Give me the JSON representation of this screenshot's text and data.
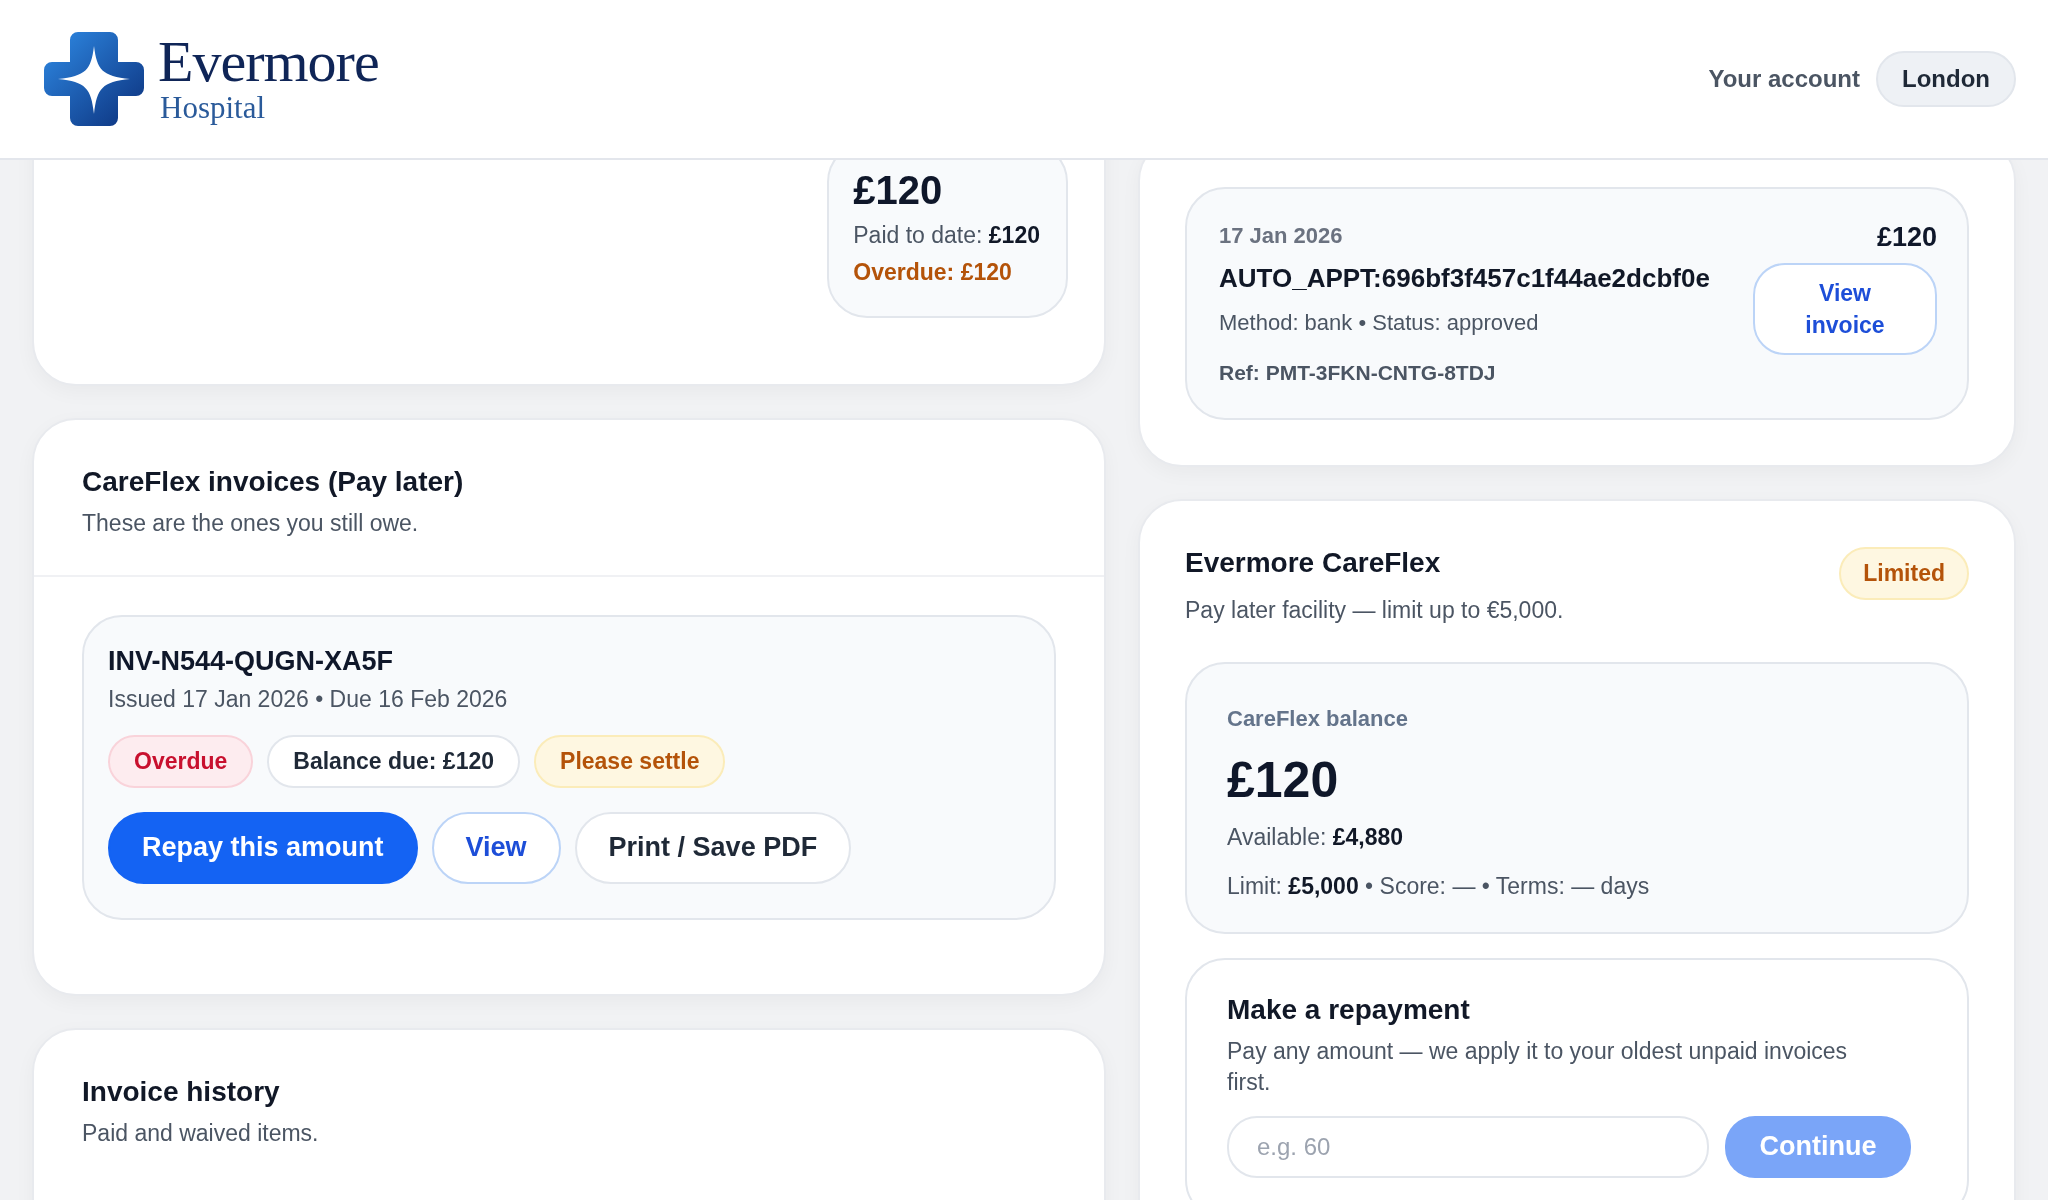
{
  "header": {
    "logo": {
      "name": "Evermore",
      "subtitle": "Hospital"
    },
    "account_link": "Your account",
    "location": "London"
  },
  "summary_card": {
    "amount": "£120",
    "paid_to_date": "Paid to date: **£120**",
    "overdue": "Overdue: £120"
  },
  "careflex_invoices": {
    "title": "CareFlex invoices (Pay later)",
    "subtitle": "These are the ones you still owe.",
    "invoices": [
      {
        "number": "INV-N544-QUGN-XA5F",
        "dates": "Issued 17 Jan 2026 • Due 16 Feb 2026",
        "tags": [
          {
            "label": "Overdue",
            "kind": "danger"
          },
          {
            "label": "Balance due: £120",
            "kind": "neutral"
          },
          {
            "label": "Please settle",
            "kind": "warning"
          }
        ],
        "actions": [
          {
            "label": "Repay this amount",
            "kind": "primary"
          },
          {
            "label": "View",
            "kind": "outline"
          },
          {
            "label": "Print / Save PDF",
            "kind": "plain"
          }
        ]
      }
    ]
  },
  "invoice_history": {
    "title": "Invoice history",
    "subtitle": "Paid and waived items."
  },
  "payments": [
    {
      "date": "17 Jan 2026",
      "amount": "£120",
      "reference": "AUTO_APPT:696bf3f457c1f44ae2dcbf0e",
      "details": "Method: bank • Status: approved",
      "ref": "Ref: PMT-3FKN-CNTG-8TDJ",
      "action": "View invoice"
    }
  ],
  "careflex": {
    "title": "Evermore CareFlex",
    "badge": {
      "label": "Limited",
      "kind": "warning"
    },
    "subtitle": "Pay later facility — limit up to €5,000.",
    "balance": {
      "label": "CareFlex balance",
      "amount": "£120",
      "available": "Available: **£4,880**",
      "limit_line": "Limit: **£5,000** • Score: — • Terms: — days"
    }
  },
  "repayment": {
    "title": "Make a repayment",
    "description": "Pay any amount — we apply it to your oldest unpaid invoices first.",
    "input": {
      "placeholder": "e.g. 60"
    },
    "button": {
      "label": "Continue",
      "disabled": true
    }
  }
}
